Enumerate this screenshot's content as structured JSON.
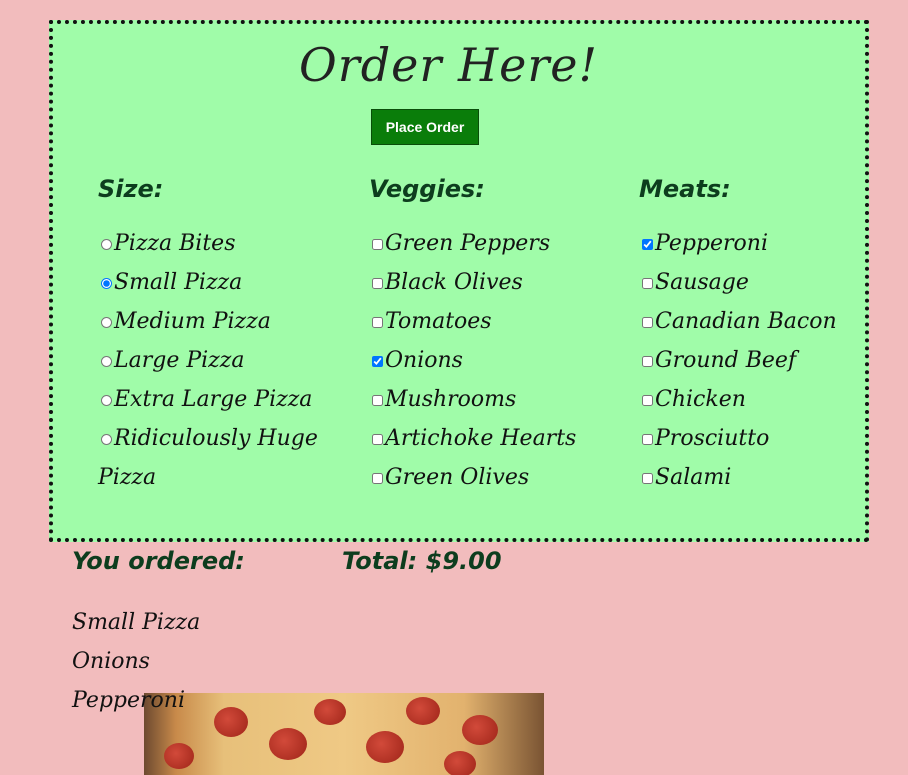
{
  "header": {
    "title": "Order Here!",
    "place_order_label": "Place Order"
  },
  "size": {
    "heading": "Size:",
    "options": [
      {
        "label": "Pizza Bites",
        "selected": false
      },
      {
        "label": "Small Pizza",
        "selected": true
      },
      {
        "label": "Medium Pizza",
        "selected": false
      },
      {
        "label": "Large Pizza",
        "selected": false
      },
      {
        "label": "Extra Large Pizza",
        "selected": false
      },
      {
        "label": "Ridiculously Huge Pizza",
        "selected": false
      }
    ]
  },
  "veggies": {
    "heading": "Veggies:",
    "options": [
      {
        "label": "Green Peppers",
        "checked": false
      },
      {
        "label": "Black Olives",
        "checked": false
      },
      {
        "label": "Tomatoes",
        "checked": false
      },
      {
        "label": "Onions",
        "checked": true
      },
      {
        "label": "Mushrooms",
        "checked": false
      },
      {
        "label": "Artichoke Hearts",
        "checked": false
      },
      {
        "label": "Green Olives",
        "checked": false
      }
    ]
  },
  "meats": {
    "heading": "Meats:",
    "options": [
      {
        "label": "Pepperoni",
        "checked": true
      },
      {
        "label": "Sausage",
        "checked": false
      },
      {
        "label": "Canadian Bacon",
        "checked": false
      },
      {
        "label": "Ground Beef",
        "checked": false
      },
      {
        "label": "Chicken",
        "checked": false
      },
      {
        "label": "Prosciutto",
        "checked": false
      },
      {
        "label": "Salami",
        "checked": false
      }
    ]
  },
  "summary": {
    "you_ordered_label": "You ordered:",
    "total_label": "Total: $9.00",
    "items": [
      "Small Pizza",
      "Onions",
      "Pepperoni"
    ]
  },
  "colors": {
    "page_background": "#f2bcbd",
    "order_box_background": "#a0fca9",
    "button_background": "#0a7d0a",
    "heading_color": "#0d3d1e"
  }
}
